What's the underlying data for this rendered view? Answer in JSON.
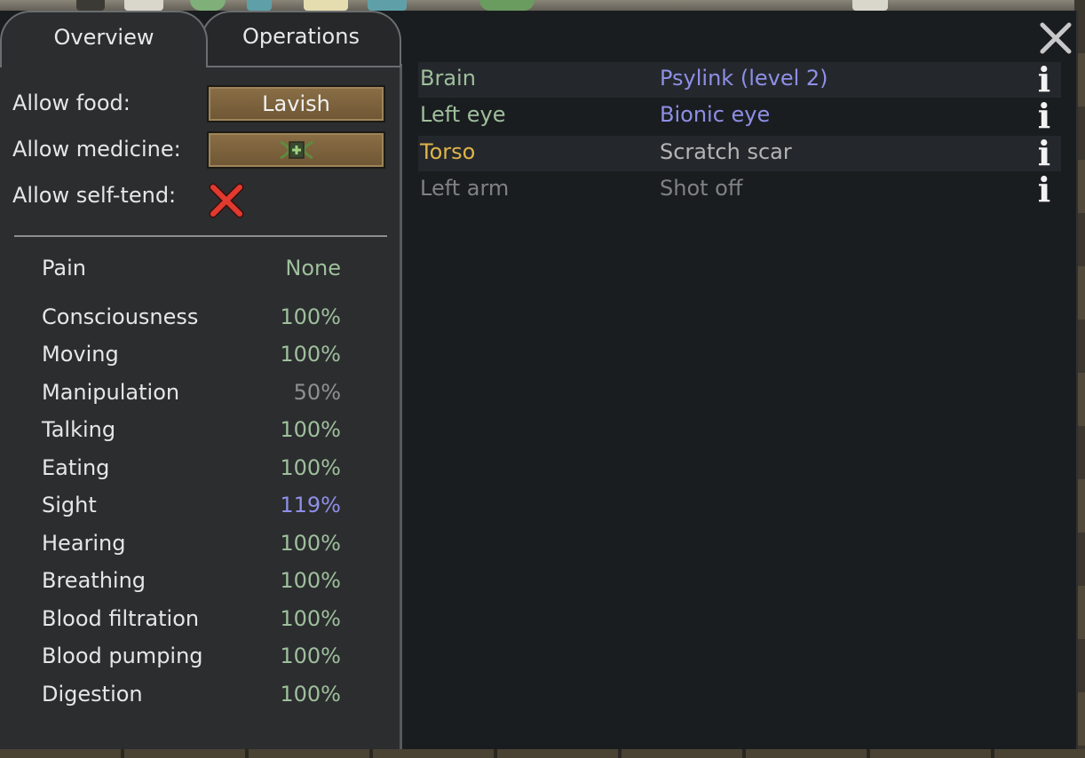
{
  "tabs": [
    {
      "label": "Overview",
      "active": true
    },
    {
      "label": "Operations",
      "active": false
    }
  ],
  "close_icon": "close-x-icon",
  "settings": {
    "allow_food": {
      "label": "Allow food:",
      "value": "Lavish"
    },
    "allow_medicine": {
      "label": "Allow medicine:",
      "icon": "herbal-medicine-icon"
    },
    "allow_self_tend": {
      "label": "Allow self-tend:",
      "icon": "red-cross-icon",
      "enabled": false
    }
  },
  "capacities": [
    {
      "name": "Pain",
      "value": "None",
      "color": "#9fbf9c"
    },
    {
      "name": "Consciousness",
      "value": "100%",
      "color": "#9fbf9c"
    },
    {
      "name": "Moving",
      "value": "100%",
      "color": "#9fbf9c"
    },
    {
      "name": "Manipulation",
      "value": "50%",
      "color": "#8f9190"
    },
    {
      "name": "Talking",
      "value": "100%",
      "color": "#9fbf9c"
    },
    {
      "name": "Eating",
      "value": "100%",
      "color": "#9fbf9c"
    },
    {
      "name": "Sight",
      "value": "119%",
      "color": "#8f8fe6"
    },
    {
      "name": "Hearing",
      "value": "100%",
      "color": "#9fbf9c"
    },
    {
      "name": "Breathing",
      "value": "100%",
      "color": "#9fbf9c"
    },
    {
      "name": "Blood filtration",
      "value": "100%",
      "color": "#9fbf9c"
    },
    {
      "name": "Blood pumping",
      "value": "100%",
      "color": "#9fbf9c"
    },
    {
      "name": "Digestion",
      "value": "100%",
      "color": "#9fbf9c"
    }
  ],
  "health_conditions": [
    {
      "part": "Brain",
      "condition": "Psylink (level 2)",
      "part_color": "#9fbf9c",
      "condition_color": "#8f8fe6",
      "icon": "info-icon"
    },
    {
      "part": "Left eye",
      "condition": "Bionic eye",
      "part_color": "#9fbf9c",
      "condition_color": "#8f8fe6",
      "icon": "info-icon"
    },
    {
      "part": "Torso",
      "condition": "Scratch scar",
      "part_color": "#e0b44a",
      "condition_color": "#b4b4b4",
      "icon": "info-icon"
    },
    {
      "part": "Left arm",
      "condition": "Shot off",
      "part_color": "#7f8183",
      "condition_color": "#7f8183",
      "icon": "info-icon"
    }
  ]
}
